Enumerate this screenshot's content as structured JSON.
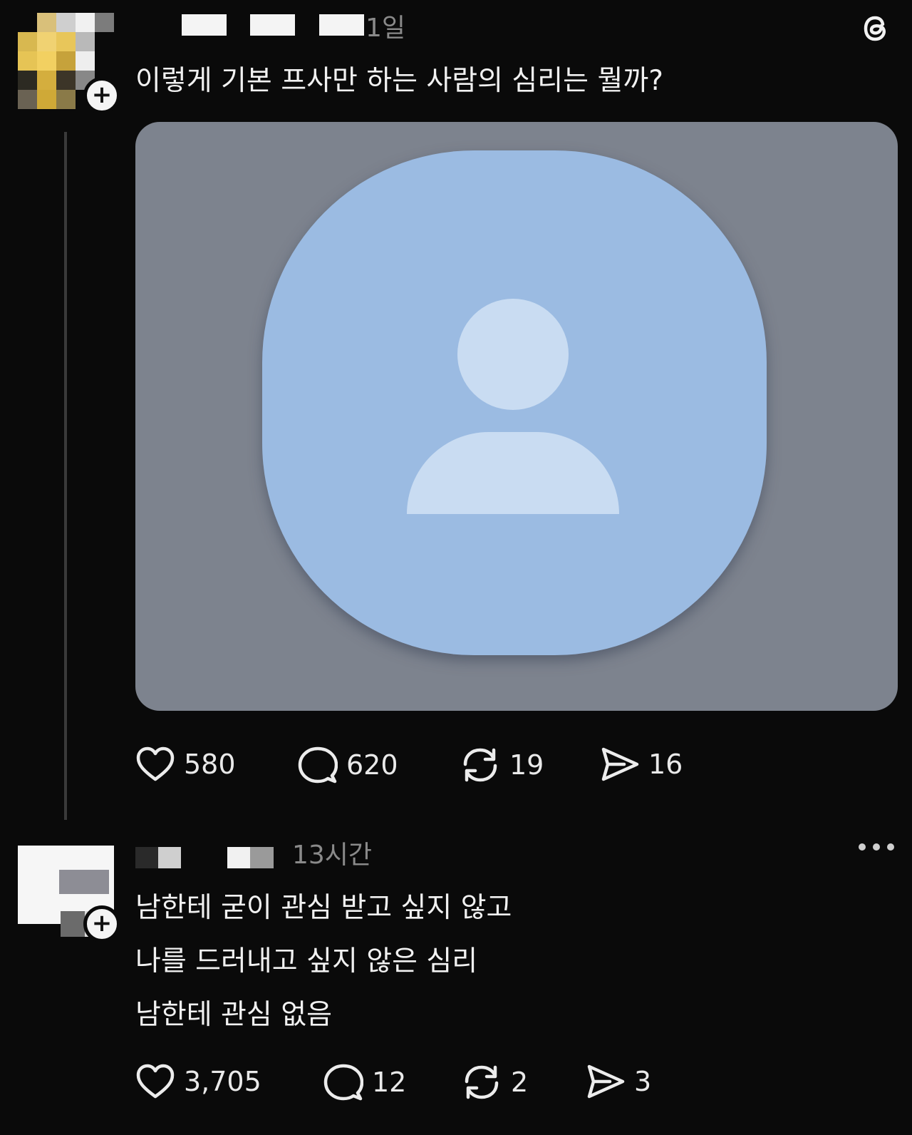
{
  "post": {
    "time": "1일",
    "text": "이렇게 기본 프사만 하는 사람의 심리는 뭘까?",
    "media_icon": "default-profile-person-icon",
    "likes": "580",
    "comments": "620",
    "reposts": "19",
    "shares": "16"
  },
  "reply": {
    "time": "13시간",
    "lines": [
      "남한테 굳이 관심 받고 싶지 않고",
      "나를 드러내고 싶지 않은 심리",
      "남한테 관심 없음"
    ],
    "likes": "3,705",
    "comments": "12",
    "reposts": "2",
    "shares": "3"
  },
  "icons": {
    "app_logo": "threads-logo-icon",
    "follow_badge": "plus-icon",
    "like": "heart-icon",
    "comment": "comment-bubble-icon",
    "repost": "repost-icon",
    "share": "send-icon",
    "more": "more-dots-icon"
  }
}
